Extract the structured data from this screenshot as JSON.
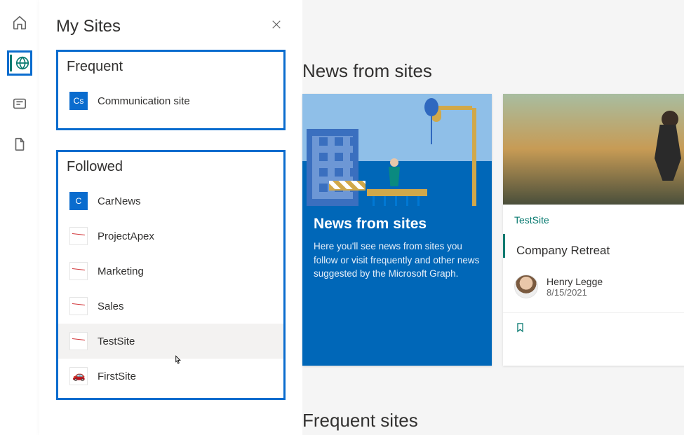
{
  "flyout": {
    "title": "My Sites",
    "frequent": {
      "heading": "Frequent",
      "items": [
        {
          "badge": "Cs",
          "name": "Communication site",
          "iconType": "cs"
        }
      ]
    },
    "followed": {
      "heading": "Followed",
      "items": [
        {
          "badge": "C",
          "name": "CarNews",
          "iconType": "c"
        },
        {
          "badge": "",
          "name": "ProjectApex",
          "iconType": "chart"
        },
        {
          "badge": "",
          "name": "Marketing",
          "iconType": "chart"
        },
        {
          "badge": "",
          "name": "Sales",
          "iconType": "chart"
        },
        {
          "badge": "",
          "name": "TestSite",
          "iconType": "chart",
          "hover": true
        },
        {
          "badge": "",
          "name": "FirstSite",
          "iconType": "car"
        }
      ]
    }
  },
  "main": {
    "newsHeading": "News from sites",
    "frequentHeading": "Frequent sites",
    "newsCard": {
      "title": "News from sites",
      "description": "Here you'll see news from sites you follow or visit frequently and other news suggested by the Microsoft Graph."
    },
    "postCard": {
      "siteName": "TestSite",
      "postTitle": "Company Retreat",
      "authorName": "Henry Legge",
      "date": "8/15/2021"
    }
  },
  "colors": {
    "primaryBlue": "#0a6cce",
    "teal": "#087a70",
    "msBlue": "#0067b8"
  }
}
